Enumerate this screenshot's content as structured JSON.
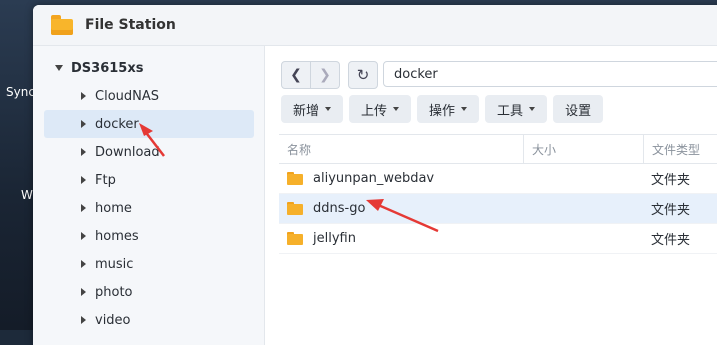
{
  "desktop": {
    "labels": [
      "Sync",
      "W"
    ]
  },
  "window": {
    "title": "File Station"
  },
  "sidebar": {
    "root": "DS3615xs",
    "items": [
      {
        "label": "CloudNAS",
        "selected": false
      },
      {
        "label": "docker",
        "selected": true
      },
      {
        "label": "Download",
        "selected": false
      },
      {
        "label": "Ftp",
        "selected": false
      },
      {
        "label": "home",
        "selected": false
      },
      {
        "label": "homes",
        "selected": false
      },
      {
        "label": "music",
        "selected": false
      },
      {
        "label": "photo",
        "selected": false
      },
      {
        "label": "video",
        "selected": false
      }
    ]
  },
  "path": {
    "value": "docker"
  },
  "toolbar": {
    "create": "新增",
    "upload": "上传",
    "action": "操作",
    "tools": "工具",
    "settings": "设置"
  },
  "table": {
    "columns": [
      "名称",
      "大小",
      "文件类型"
    ],
    "rows": [
      {
        "name": "aliyunpan_webdav",
        "size": "",
        "type": "文件夹",
        "selected": false
      },
      {
        "name": "ddns-go",
        "size": "",
        "type": "文件夹",
        "selected": true
      },
      {
        "name": "jellyfin",
        "size": "",
        "type": "文件夹",
        "selected": false
      }
    ]
  },
  "colors": {
    "accent": "#f3a520",
    "selection": "#dde9f7",
    "annotation": "#e53935"
  }
}
